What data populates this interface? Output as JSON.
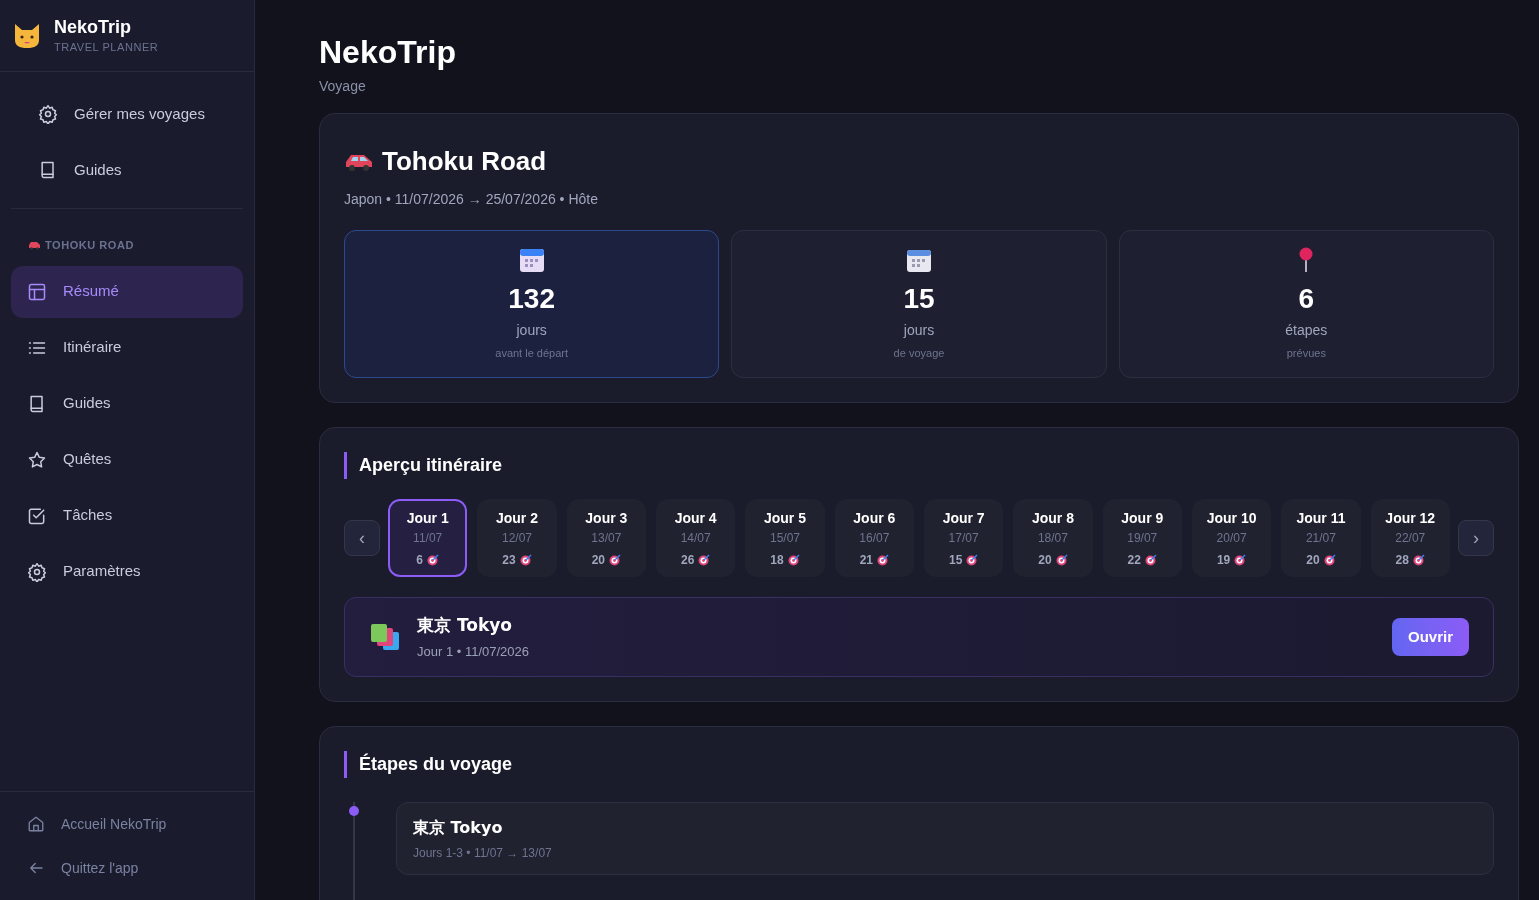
{
  "brand": {
    "name": "NekoTrip",
    "tagline": "TRAVEL PLANNER"
  },
  "sidebar": {
    "top_items": [
      {
        "label": "Gérer mes voyages",
        "selected": false
      },
      {
        "label": "Guides",
        "selected": false
      }
    ],
    "section_label": "TOHOKU ROAD",
    "items": [
      {
        "label": "Résumé",
        "selected": true
      },
      {
        "label": "Itinéraire",
        "selected": false
      },
      {
        "label": "Guides",
        "selected": false
      },
      {
        "label": "Quêtes",
        "selected": false
      },
      {
        "label": "Tâches",
        "selected": false
      },
      {
        "label": "Paramètres",
        "selected": false
      }
    ],
    "footer_items": [
      {
        "label": "Accueil NekoTrip"
      },
      {
        "label": "Quittez l'app"
      }
    ]
  },
  "page": {
    "title": "NekoTrip",
    "subtitle": "Voyage"
  },
  "trip": {
    "title": "Tohoku Road",
    "meta": "Japon • 11/07/2026 → 25/07/2026 • Hôte",
    "stats": [
      {
        "value": "132",
        "unit": "jours",
        "caption": "avant le départ",
        "selected": true
      },
      {
        "value": "15",
        "unit": "jours",
        "caption": "de voyage",
        "selected": false
      },
      {
        "value": "6",
        "unit": "étapes",
        "caption": "prévues",
        "selected": false
      }
    ]
  },
  "overview": {
    "title": "Aperçu itinéraire",
    "prev": "‹",
    "next": "›",
    "days": [
      {
        "label": "Jour 1",
        "date": "11/07",
        "count": "6",
        "selected": true
      },
      {
        "label": "Jour 2",
        "date": "12/07",
        "count": "23",
        "selected": false
      },
      {
        "label": "Jour 3",
        "date": "13/07",
        "count": "20",
        "selected": false
      },
      {
        "label": "Jour 4",
        "date": "14/07",
        "count": "26",
        "selected": false
      },
      {
        "label": "Jour 5",
        "date": "15/07",
        "count": "18",
        "selected": false
      },
      {
        "label": "Jour 6",
        "date": "16/07",
        "count": "21",
        "selected": false
      },
      {
        "label": "Jour 7",
        "date": "17/07",
        "count": "15",
        "selected": false
      },
      {
        "label": "Jour 8",
        "date": "18/07",
        "count": "20",
        "selected": false
      },
      {
        "label": "Jour 9",
        "date": "19/07",
        "count": "22",
        "selected": false
      },
      {
        "label": "Jour 10",
        "date": "20/07",
        "count": "19",
        "selected": false
      },
      {
        "label": "Jour 11",
        "date": "21/07",
        "count": "20",
        "selected": false
      },
      {
        "label": "Jour 12",
        "date": "22/07",
        "count": "28",
        "selected": false
      }
    ],
    "detail": {
      "title": "東京 Tokyo",
      "meta": "Jour 1 • 11/07/2026",
      "button": "Ouvrir"
    }
  },
  "stages": {
    "title": "Étapes du voyage",
    "items": [
      {
        "title": "東京 Tokyo",
        "meta": "Jours 1-3 • 11/07 → 13/07"
      }
    ]
  }
}
